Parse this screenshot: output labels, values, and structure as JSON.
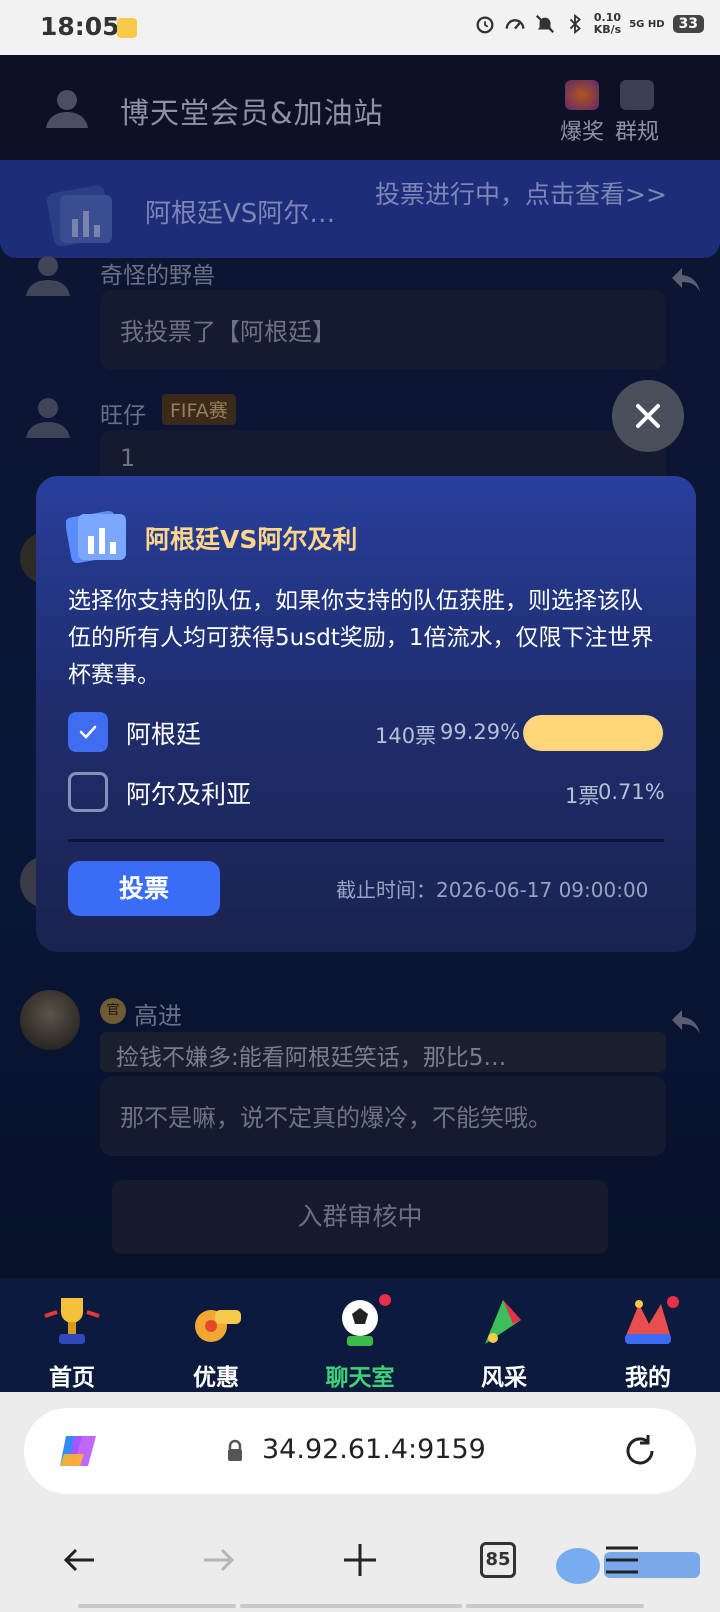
{
  "status_bar": {
    "time": "18:05",
    "net_speed_value": "0.10",
    "net_speed_unit": "KB/s",
    "network": "5G HD",
    "battery": "33"
  },
  "header": {
    "title": "博天堂会员&加油站",
    "jackpot_label": "爆奖",
    "rules_label": "群规"
  },
  "vote_banner": {
    "title": "阿根廷VS阿尔…",
    "status": "投票进行中，点击查看>>"
  },
  "messages": [
    {
      "name": "奇怪的野兽",
      "text": "我投票了【阿根廷】"
    },
    {
      "name": "旺仔",
      "tag": "FIFA赛",
      "text": "1"
    },
    {
      "name": "高进",
      "badge": "官",
      "quote": "捡钱不嫌多:能看阿根廷笑话，那比5…",
      "text": "那不是嘛，说不定真的爆冷，不能笑哦。"
    }
  ],
  "poll_modal": {
    "title": "阿根廷VS阿尔及利",
    "description": "选择你支持的队伍，如果你支持的队伍获胜，则选择该队伍的所有人均可获得5usdt奖励，1倍流水，仅限下注世界杯赛事。",
    "options": [
      {
        "label": "阿根廷",
        "votes": "140票",
        "percent": "99.29%",
        "fraction": 0.9929,
        "checked": true
      },
      {
        "label": "阿尔及利亚",
        "votes": "1票",
        "percent": "0.71%",
        "fraction": 0.0071,
        "checked": false
      }
    ],
    "vote_button": "投票",
    "deadline": "截止时间：2026-06-17 09:00:00"
  },
  "join_status": "入群审核中",
  "bottom_nav": [
    {
      "label": "首页",
      "icon": "trophy-icon",
      "active": false
    },
    {
      "label": "优惠",
      "icon": "whistle-icon",
      "active": false
    },
    {
      "label": "聊天室",
      "icon": "soccer-ball-icon",
      "active": true
    },
    {
      "label": "风采",
      "icon": "party-horn-icon",
      "active": false
    },
    {
      "label": "我的",
      "icon": "jester-hat-icon",
      "active": false
    }
  ],
  "browser": {
    "url": "34.92.61.4:9159",
    "tab_count": "85"
  },
  "colors": {
    "modal_accent": "#ffd68a",
    "checkbox_on": "#3f6cf0",
    "bar_fill": "#ffd77a",
    "nav_active": "#3dd17a"
  }
}
